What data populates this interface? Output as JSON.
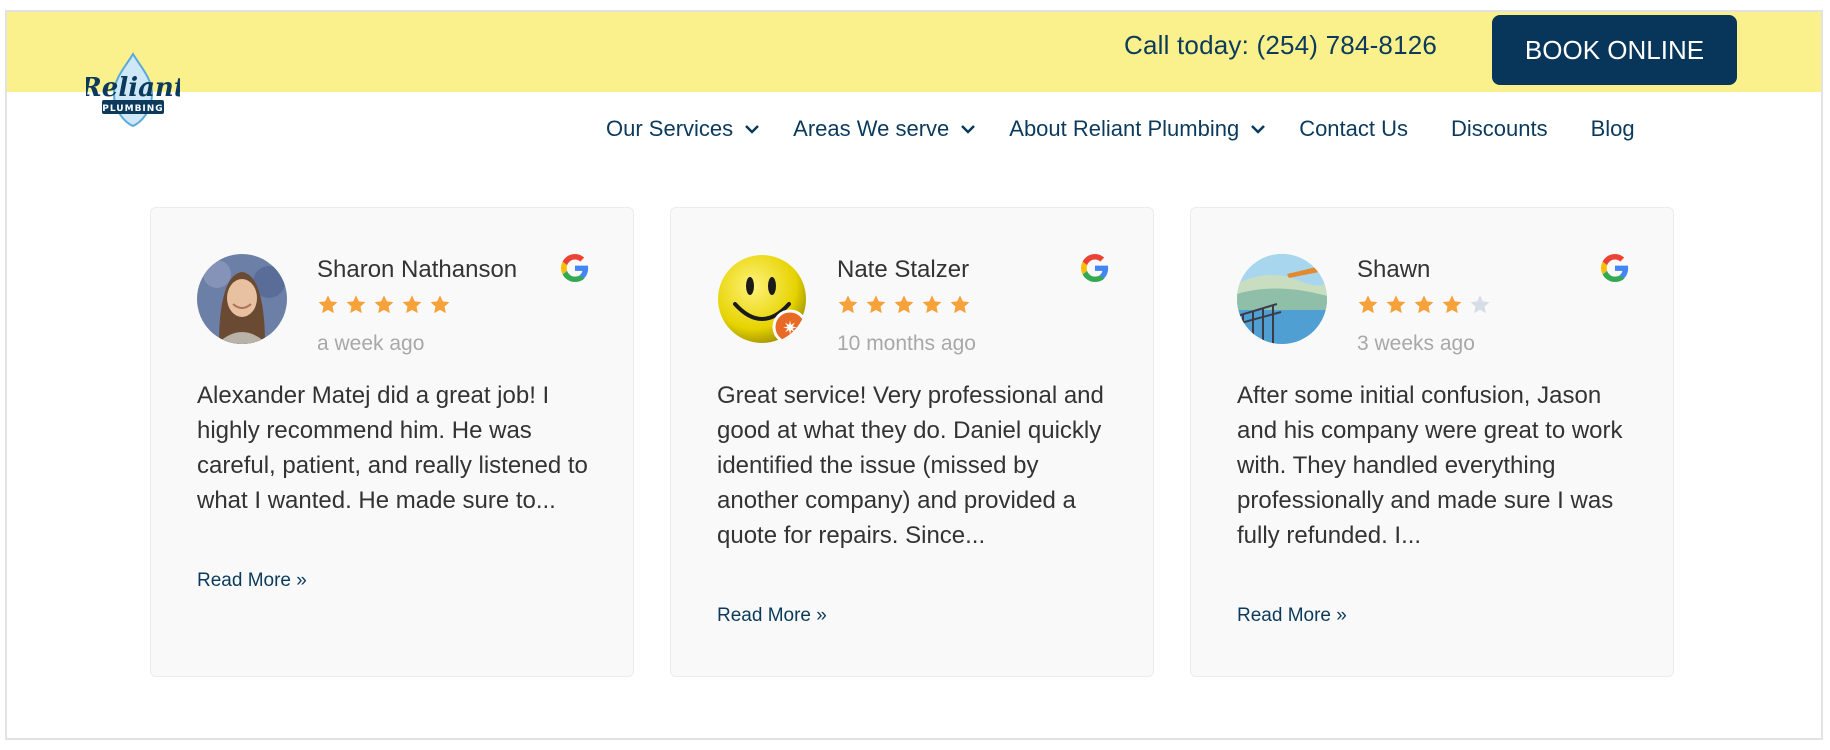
{
  "brand": {
    "name": "Reliant",
    "tagline": "PLUMBING",
    "accent_yellow": "#faf18c",
    "navy": "#07365a",
    "star_color": "#f6a13a",
    "star_empty_color": "#d6dde6"
  },
  "header": {
    "phone_text": "Call today: (254) 784-8126",
    "book_label": "BOOK ONLINE"
  },
  "nav": {
    "items": [
      {
        "label": "Our Services",
        "dropdown": true
      },
      {
        "label": "Areas We serve",
        "dropdown": true
      },
      {
        "label": "About Reliant Plumbing",
        "dropdown": true
      },
      {
        "label": "Contact Us",
        "dropdown": false
      },
      {
        "label": "Discounts",
        "dropdown": false
      },
      {
        "label": "Blog",
        "dropdown": false
      }
    ]
  },
  "reviews": [
    {
      "name": "Sharon Nathanson",
      "rating": 5,
      "date": "a week ago",
      "text": "Alexander Matej did a great job! I highly recommend him. He was careful, patient, and really listened to what I wanted. He made sure to...",
      "read_more": "Read More »",
      "avatar": "photo-avatar"
    },
    {
      "name": "Nate Stalzer",
      "rating": 5,
      "date": "10 months ago",
      "text": "Great service! Very professional and good at what they do. Daniel quickly identified the issue (missed by another company) and provided a quote for repairs. Since...",
      "read_more": "Read More »",
      "avatar": "smiley-avatar"
    },
    {
      "name": "Shawn",
      "rating": 4,
      "date": "3 weeks ago",
      "text": "After some initial confusion, Jason and his company were great to work with. They handled everything professionally and made sure I was fully refunded. I...",
      "read_more": "Read More »",
      "avatar": "landscape-avatar"
    }
  ]
}
